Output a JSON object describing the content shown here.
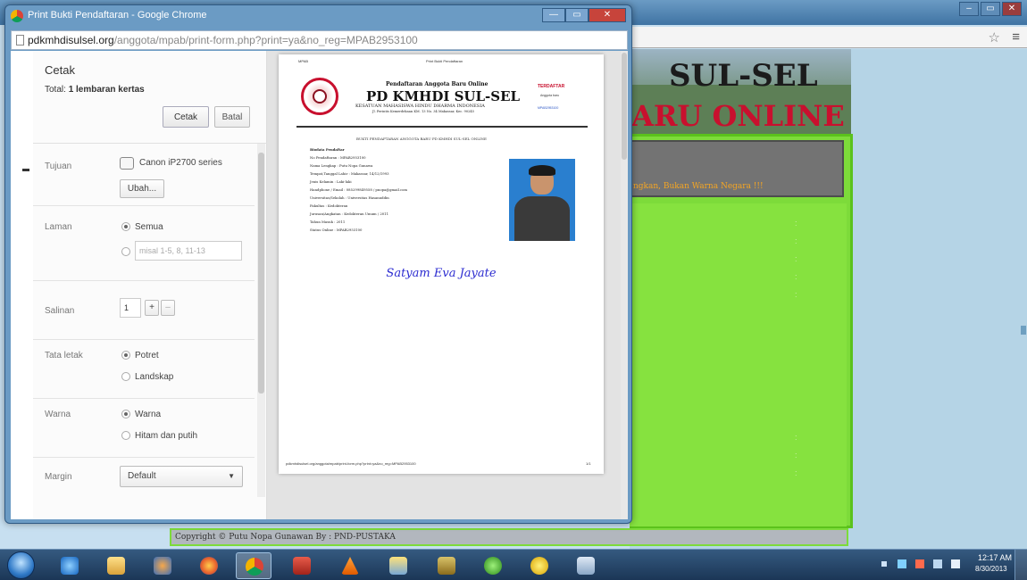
{
  "bg_site": {
    "banner_line1": "SUL-SEL",
    "banner_line2": "ARU ONLINE",
    "info_text": "ngkan, Bukan Warna Negara !!!",
    "footer_text": "Copyright © Putu Nopa Gunawan By : PND-PUSTAKA"
  },
  "print_window": {
    "title": "Print Bukti Pendaftaran - Google Chrome",
    "url_host": "pdkmhdisulsel.org",
    "url_path": "/anggota/mpab/print-form.php?print=ya&no_reg=MPAB2953100",
    "controls": {
      "minimize": "—",
      "maximize": "▭",
      "close": "✕"
    }
  },
  "print_settings": {
    "title": "Cetak",
    "total_prefix": "Total: ",
    "total_value": "1 lembaran kertas",
    "print_button": "Cetak",
    "cancel_button": "Batal",
    "destination": {
      "label": "Tujuan",
      "printer": "Canon iP2700 series",
      "change_button": "Ubah..."
    },
    "pages": {
      "label": "Laman",
      "all": "Semua",
      "custom_placeholder": "misal 1-5, 8, 11-13"
    },
    "copies": {
      "label": "Salinan",
      "value": "1",
      "plus": "+",
      "minus": "–"
    },
    "layout": {
      "label": "Tata letak",
      "portrait": "Potret",
      "landscape": "Landskap"
    },
    "color": {
      "label": "Warna",
      "color_option": "Warna",
      "bw_option": "Hitam dan putih"
    },
    "margins": {
      "label": "Margin",
      "value": "Default"
    }
  },
  "preview": {
    "head_left": "MPAB",
    "head_right": "Print Bukti Pendaftaran",
    "org_sub": "Pendaftaran Anggota Baru Online",
    "org_name": "PD KMHDI SUL-SEL",
    "org_full": "KESATUAN MAHASISWA HINDU DHARMA INDONESIA",
    "org_addr": "Jl. Perintis Kemerdekaan KM. 13 No. 34 Makassar, Kec. 90245",
    "reg_label": "TERDAFTAR",
    "reg_sub1": "Anggota baru",
    "reg_sub2": "MPAB2953100",
    "proof_title": "BUKTI PENDAFTARAN ANGGOTA BARU PD KMHDI SUL-SEL ONLINE",
    "fields": [
      "Biodata Pendaftar",
      "No Pendaftaran  :  MPAB2953100",
      "Nama Lengkap  :  Putu Nopa Gunawa",
      "Tempat,Tanggal Lahir  :  Makassar, 14/12/1993",
      "Jenis Kelamin  :  Laki-laki",
      "Handphone / Email  :  085299849558 / pnopa@gmail.com",
      "Universitas/Sekolah  :  Universitas Hasanuddin",
      "Fakultas  :  Kedokteran",
      "Jurusan/Angkatan  :  Kedokteran Umum / 2011",
      "Tahun Masuk  :  2011",
      "Status Online  :  MPAB2953100"
    ],
    "motto": "Satyam Eva Jayate",
    "foot_left": "pdkmhdisulsel.org/anggota/mpab/print-form.php?print=ya&no_reg=MPAB2953100",
    "foot_right": "1/1"
  },
  "taskbar": {
    "items": [
      "internet-explorer",
      "file-explorer",
      "media-player",
      "firefox",
      "chrome",
      "books-app",
      "vlc",
      "photos",
      "music-app",
      "green-app",
      "yellow-app",
      "calculator"
    ],
    "clock_time": "12:17 AM",
    "clock_date": "8/30/2013"
  }
}
